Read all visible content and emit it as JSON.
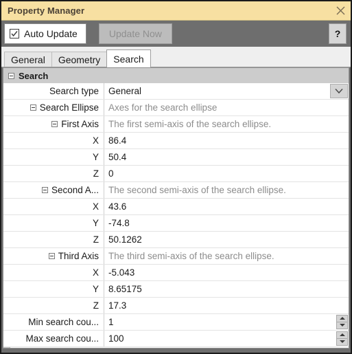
{
  "window": {
    "title": "Property Manager",
    "close_icon": "close-icon"
  },
  "toolbar": {
    "auto_update_label": "Auto Update",
    "auto_update_checked": true,
    "update_now_label": "Update Now",
    "update_now_disabled": true,
    "help_label": "?"
  },
  "tabs": [
    {
      "label": "General",
      "active": false
    },
    {
      "label": "Geometry",
      "active": false
    },
    {
      "label": "Search",
      "active": true
    }
  ],
  "grid": {
    "group_title": "Search",
    "rows": [
      {
        "label": "Search type",
        "value": "General",
        "kind": "dropdown",
        "indent": 0,
        "expander": false,
        "desc": false
      },
      {
        "label": "Search Ellipse",
        "value": "Axes for the search ellipse",
        "kind": "text",
        "indent": 0,
        "expander": true,
        "desc": true
      },
      {
        "label": "First Axis",
        "value": "The first semi-axis of the search ellipse.",
        "kind": "text",
        "indent": 1,
        "expander": true,
        "desc": true
      },
      {
        "label": "X",
        "value": "86.4",
        "kind": "text",
        "indent": 2,
        "expander": false,
        "desc": false
      },
      {
        "label": "Y",
        "value": "50.4",
        "kind": "text",
        "indent": 2,
        "expander": false,
        "desc": false
      },
      {
        "label": "Z",
        "value": "0",
        "kind": "text",
        "indent": 2,
        "expander": false,
        "desc": false
      },
      {
        "label": "Second A...",
        "value": "The second semi-axis of the search ellipse.",
        "kind": "text",
        "indent": 1,
        "expander": true,
        "desc": true
      },
      {
        "label": "X",
        "value": "43.6",
        "kind": "text",
        "indent": 2,
        "expander": false,
        "desc": false
      },
      {
        "label": "Y",
        "value": "-74.8",
        "kind": "text",
        "indent": 2,
        "expander": false,
        "desc": false
      },
      {
        "label": "Z",
        "value": "50.1262",
        "kind": "text",
        "indent": 2,
        "expander": false,
        "desc": false
      },
      {
        "label": "Third Axis",
        "value": "The third semi-axis of the search ellipse.",
        "kind": "text",
        "indent": 1,
        "expander": true,
        "desc": true
      },
      {
        "label": "X",
        "value": "-5.043",
        "kind": "text",
        "indent": 2,
        "expander": false,
        "desc": false
      },
      {
        "label": "Y",
        "value": "8.65175",
        "kind": "text",
        "indent": 2,
        "expander": false,
        "desc": false
      },
      {
        "label": "Z",
        "value": "17.3",
        "kind": "text",
        "indent": 2,
        "expander": false,
        "desc": false
      },
      {
        "label": "Min search cou...",
        "value": "1",
        "kind": "spinner",
        "indent": 0,
        "expander": false,
        "desc": false
      },
      {
        "label": "Max search cou...",
        "value": "100",
        "kind": "spinner",
        "indent": 0,
        "expander": false,
        "desc": false
      }
    ]
  },
  "colors": {
    "titlebar": "#f7e0a2",
    "toolbar": "#6e6e6e",
    "group_header": "#cccccc",
    "description_text": "#8c8c8c",
    "value_text": "#1a1a1a"
  }
}
